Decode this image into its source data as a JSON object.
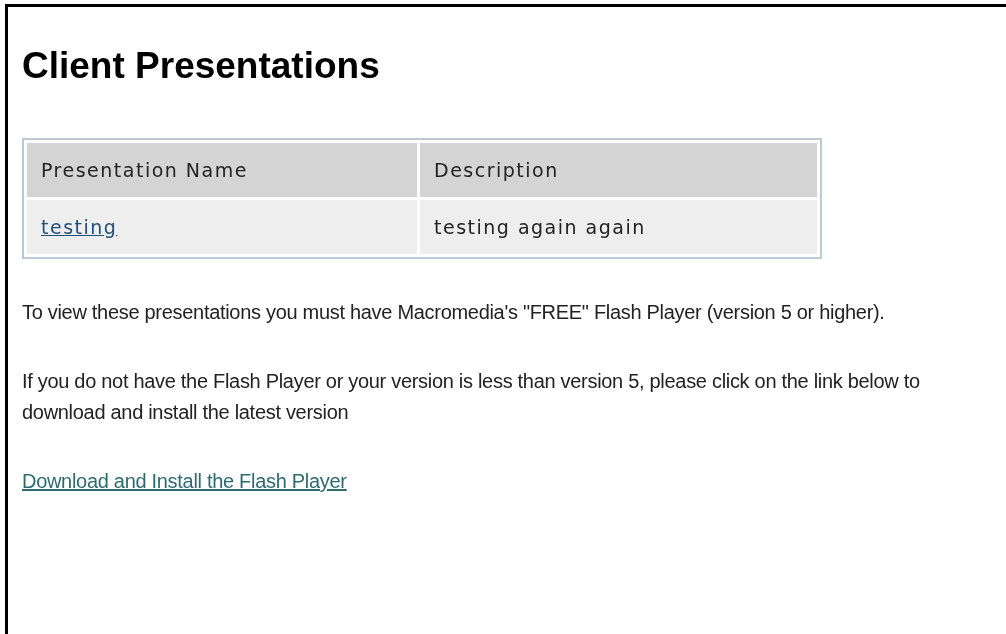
{
  "title": "Client Presentations",
  "table": {
    "columns": [
      "Presentation Name",
      "Description"
    ],
    "rows": [
      {
        "name": "testing",
        "description": "testing again again"
      }
    ]
  },
  "paragraphs": [
    "To view these presentations you must have Macromedia's \"FREE\" Flash Player (version 5 or higher).",
    "If you do not have the Flash Player or your version is less than version 5, please click on the link below to download and install the latest version"
  ],
  "download_link": "Download and Install the Flash Player"
}
